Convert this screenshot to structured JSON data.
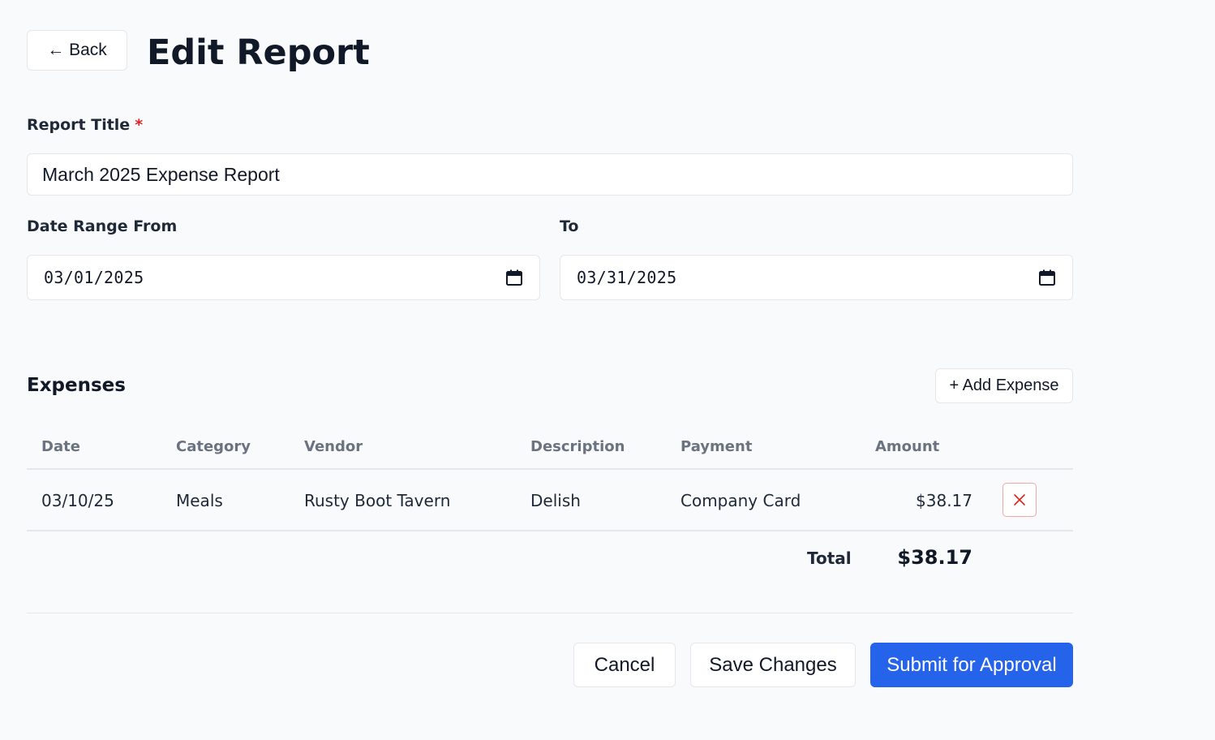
{
  "header": {
    "back_label": "← Back",
    "title": "Edit Report"
  },
  "form": {
    "report_title_label": "Report Title",
    "required_marker": "*",
    "report_title_value": "March 2025 Expense Report",
    "date_from_label": "Date Range From",
    "date_from_value": "03/01/2025",
    "date_to_label": "To",
    "date_to_value": "03/31/2025"
  },
  "expenses": {
    "section_title": "Expenses",
    "add_label": "+ Add Expense",
    "columns": [
      "Date",
      "Category",
      "Vendor",
      "Description",
      "Payment",
      "Amount"
    ],
    "rows": [
      {
        "date": "03/10/25",
        "category": "Meals",
        "vendor": "Rusty Boot Tavern",
        "description": "Delish",
        "payment": "Company Card",
        "amount": "$38.17"
      }
    ],
    "total_label": "Total",
    "total_value": "$38.17"
  },
  "footer": {
    "cancel_label": "Cancel",
    "save_label": "Save Changes",
    "submit_label": "Submit for Approval"
  },
  "icons": {
    "calendar": "calendar-icon",
    "delete": "close-icon"
  },
  "colors": {
    "primary": "#2563eb",
    "required": "#dc2626",
    "danger_border": "#f3a5a5",
    "page_bg": "#f8fafc"
  }
}
